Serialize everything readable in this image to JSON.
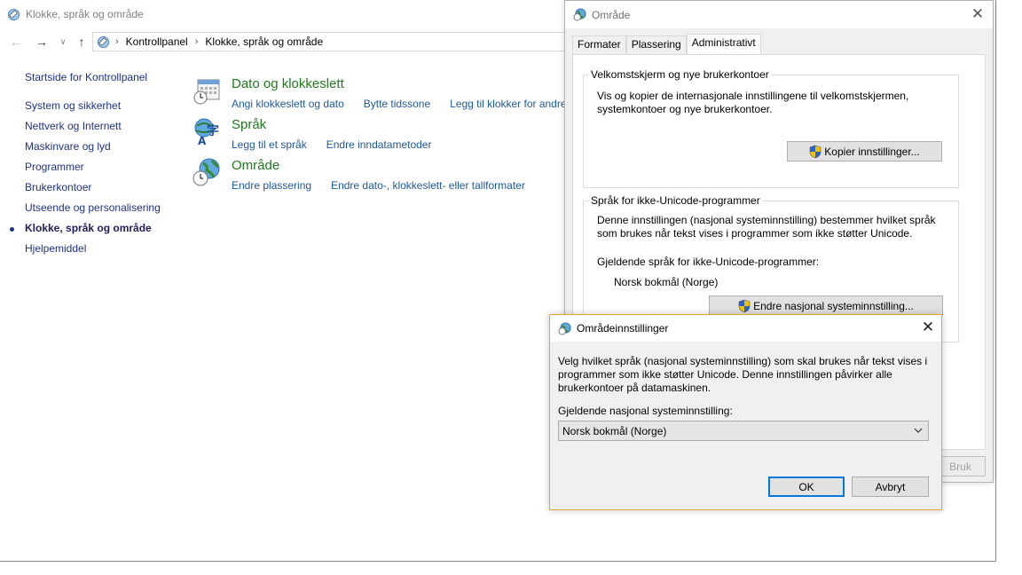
{
  "control_panel": {
    "title": "Klokke, språk og område",
    "breadcrumb": [
      "Kontrollpanel",
      "Klokke, språk og område"
    ],
    "home_link": "Startside for Kontrollpanel",
    "nav_items": [
      "System og sikkerhet",
      "Nettverk og Internett",
      "Maskinvare og lyd",
      "Programmer",
      "Brukerkontoer",
      "Utseende og personalisering",
      "Klokke, språk og område",
      "Hjelpemiddel"
    ],
    "categories": [
      {
        "title": "Dato og klokkeslett",
        "icon": "calendar-clock-icon",
        "links": [
          "Angi klokkeslett og dato",
          "Bytte tidssone",
          "Legg til klokker for andre"
        ]
      },
      {
        "title": "Språk",
        "icon": "language-icon",
        "links": [
          "Legg til et språk",
          "Endre inndatametoder"
        ]
      },
      {
        "title": "Område",
        "icon": "globe-clock-icon",
        "links": [
          "Endre plassering",
          "Endre dato-, klokkeslett- eller tallformater"
        ]
      }
    ]
  },
  "region_dialog": {
    "title": "Område",
    "tabs": [
      "Formater",
      "Plassering",
      "Administrativt"
    ],
    "welcome_group": {
      "label": "Velkomstskjerm og nye brukerkontoer",
      "text": "Vis og kopier de internasjonale innstillingene til velkomstskjermen, systemkontoer og nye brukerkontoer.",
      "button": "Kopier innstillinger..."
    },
    "unicode_group": {
      "label": "Språk for ikke-Unicode-programmer",
      "text": "Denne innstillingen (nasjonal systeminnstilling) bestemmer hvilket språk som brukes når tekst vises i programmer som ikke støtter Unicode.",
      "current_label": "Gjeldende språk for ikke-Unicode-programmer:",
      "current_value": "Norsk bokmål (Norge)",
      "button": "Endre nasjonal systeminnstilling..."
    },
    "apply_button": "Bruk"
  },
  "locale_dialog": {
    "title": "Områdeinnstillinger",
    "text": "Velg hvilket språk (nasjonal systeminnstilling) som skal brukes når tekst vises i programmer som ikke støtter Unicode. Denne innstillingen påvirker alle brukerkontoer på datamaskinen.",
    "select_label": "Gjeldende nasjonal systeminnstilling:",
    "select_value": "Norsk bokmål (Norge)",
    "ok_button": "OK",
    "cancel_button": "Avbryt"
  },
  "colors": {
    "link": "#1e5aa0",
    "category_title": "#1e7a1e",
    "active_dialog_border": "#e8a33d",
    "default_button_border": "#0078d7"
  }
}
